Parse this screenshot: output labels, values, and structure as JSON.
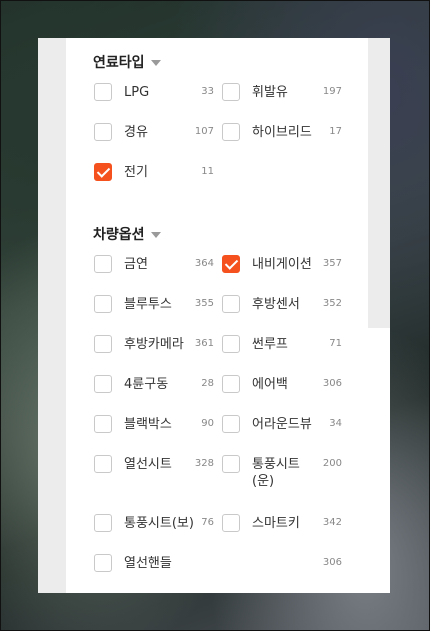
{
  "sections": {
    "fuel": {
      "title": "연료타입",
      "items": [
        {
          "label": "LPG",
          "count": "33",
          "checked": false
        },
        {
          "label": "휘발유",
          "count": "197",
          "checked": false
        },
        {
          "label": "경유",
          "count": "107",
          "checked": false
        },
        {
          "label": "하이브리드",
          "count": "17",
          "checked": false
        },
        {
          "label": "전기",
          "count": "11",
          "checked": true
        }
      ]
    },
    "options": {
      "title": "차량옵션",
      "items": [
        {
          "label": "금연",
          "count": "364",
          "checked": false
        },
        {
          "label": "내비게이션",
          "count": "357",
          "checked": true
        },
        {
          "label": "블루투스",
          "count": "355",
          "checked": false
        },
        {
          "label": "후방센서",
          "count": "352",
          "checked": false
        },
        {
          "label": "후방카메라",
          "count": "361",
          "checked": false
        },
        {
          "label": "썬루프",
          "count": "71",
          "checked": false
        },
        {
          "label": "4륜구동",
          "count": "28",
          "checked": false
        },
        {
          "label": "에어백",
          "count": "306",
          "checked": false
        },
        {
          "label": "블랙박스",
          "count": "90",
          "checked": false
        },
        {
          "label": "어라운드뷰",
          "count": "34",
          "checked": false
        },
        {
          "label": "열선시트",
          "count": "328",
          "checked": false
        },
        {
          "label": "통풍시트(운)",
          "count": "200",
          "checked": false
        },
        {
          "label": "통풍시트(보)",
          "count": "76",
          "checked": false
        },
        {
          "label": "스마트키",
          "count": "342",
          "checked": false
        },
        {
          "label": "열선핸들",
          "count": "306",
          "checked": false
        }
      ]
    }
  }
}
